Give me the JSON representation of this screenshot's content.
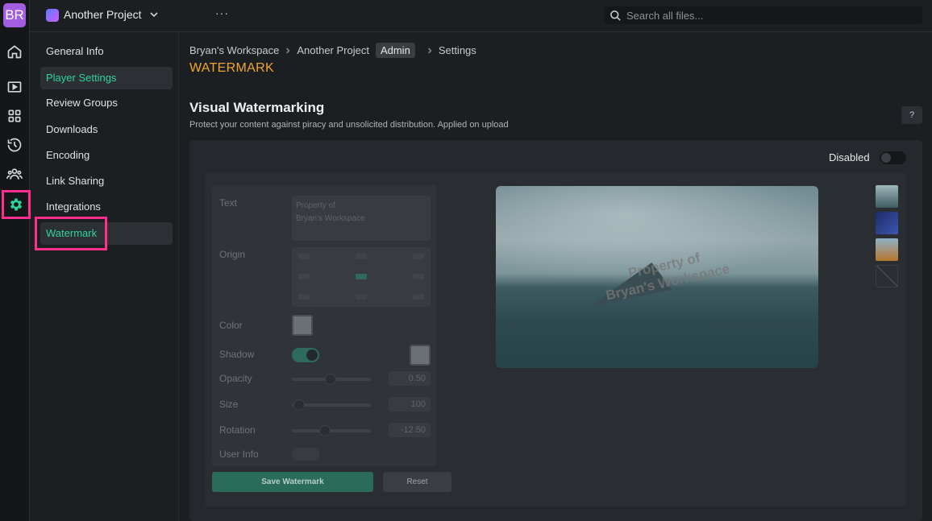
{
  "user": {
    "initials": "BR"
  },
  "project": {
    "name": "Another Project"
  },
  "top": {
    "more": "···",
    "search_placeholder": "Search all files..."
  },
  "sidebar": {
    "items": [
      {
        "label": "General Info"
      },
      {
        "label": "Player Settings"
      },
      {
        "label": "Review Groups"
      },
      {
        "label": "Downloads"
      },
      {
        "label": "Encoding"
      },
      {
        "label": "Link Sharing"
      },
      {
        "label": "Integrations"
      },
      {
        "label": "Watermark"
      }
    ]
  },
  "breadcrumb": {
    "workspace": "Bryan's Workspace",
    "project": "Another Project",
    "role": "Admin",
    "page": "Settings"
  },
  "page": {
    "title": "WATERMARK"
  },
  "section": {
    "title": "Visual Watermarking",
    "description": "Protect your content against piracy and unsolicited distribution. Applied on upload",
    "help": "?"
  },
  "toggle": {
    "label": "Disabled",
    "enabled": false
  },
  "form": {
    "text_label": "Text",
    "text_value": "Property of\nBryan's Workspace",
    "origin_label": "Origin",
    "color_label": "Color",
    "shadow_label": "Shadow",
    "opacity_label": "Opacity",
    "opacity_value": "0.50",
    "size_label": "Size",
    "size_value": "100",
    "rotation_label": "Rotation",
    "rotation_value": "-12.50",
    "userinfo_label": "User Info",
    "save_label": "Save Watermark",
    "reset_label": "Reset"
  },
  "preview": {
    "watermark_line1": "Property of",
    "watermark_line2": "Bryan's Workspace"
  },
  "colors": {
    "accent": "#2fd29a",
    "title": "#f0a431",
    "highlight": "#ff2f8e"
  }
}
